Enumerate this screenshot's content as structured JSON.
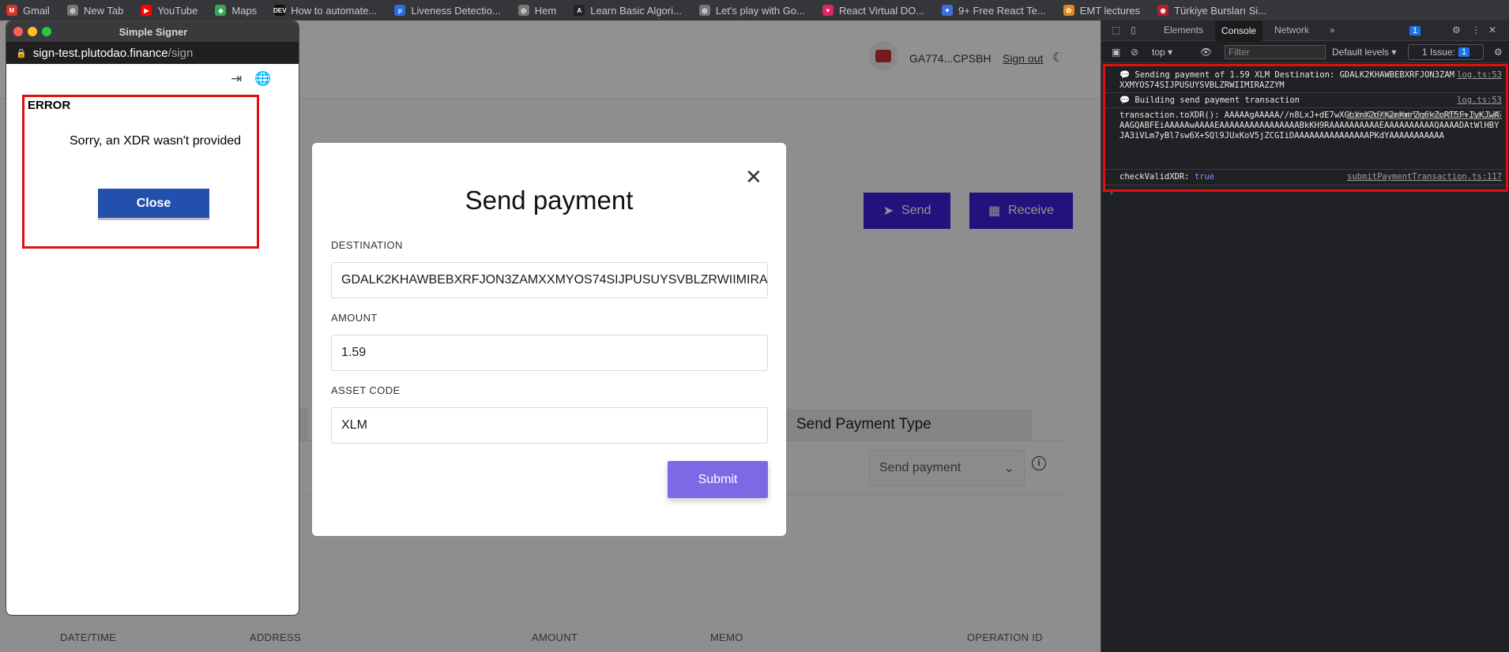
{
  "bookmarks": [
    {
      "label": "Gmail",
      "icon": "gmail-icon",
      "color": "#d93025",
      "glyph": "M"
    },
    {
      "label": "New Tab",
      "icon": "globe-icon",
      "color": "#777777",
      "glyph": "◎"
    },
    {
      "label": "YouTube",
      "icon": "youtube-icon",
      "color": "#ff0000",
      "glyph": "▶"
    },
    {
      "label": "Maps",
      "icon": "maps-icon",
      "color": "#34a853",
      "glyph": "◆"
    },
    {
      "label": "How to automate...",
      "icon": "dev-icon",
      "color": "#111111",
      "glyph": "DEV"
    },
    {
      "label": "Liveness Detectio...",
      "icon": "p-icon",
      "color": "#2b6de0",
      "glyph": "p"
    },
    {
      "label": "Hem",
      "icon": "globe-icon",
      "color": "#777777",
      "glyph": "◎"
    },
    {
      "label": "Learn Basic Algori...",
      "icon": "a-icon",
      "color": "#222222",
      "glyph": "A"
    },
    {
      "label": "Let's play with Go...",
      "icon": "globe-icon",
      "color": "#777777",
      "glyph": "◎"
    },
    {
      "label": "React Virtual DO...",
      "icon": "heart-icon",
      "color": "#e0245e",
      "glyph": "♥"
    },
    {
      "label": "9+ Free React Te...",
      "icon": "react-icon",
      "color": "#3d6ee0",
      "glyph": "✦"
    },
    {
      "label": "EMT lectures",
      "icon": "emt-icon",
      "color": "#e08a1e",
      "glyph": "✿"
    },
    {
      "label": "Türkiye Bursları Si...",
      "icon": "tb-icon",
      "color": "#b41e2e",
      "glyph": "◉"
    }
  ],
  "header": {
    "account": "GA774...CPSBH",
    "signout": "Sign out",
    "moon": "☾"
  },
  "actions": {
    "send": "Send",
    "receive": "Receive"
  },
  "payment_type": {
    "tab_label": "Send Payment Type",
    "select_value": "Send payment"
  },
  "table": {
    "headers": [
      "DATE/TIME",
      "ADDRESS",
      "AMOUNT",
      "MEMO",
      "OPERATION ID"
    ]
  },
  "modal": {
    "title": "Send payment",
    "destination_label": "DESTINATION",
    "destination_value": "GDALK2KHAWBEBXRFJON3ZAMXXMYOS74SIJPUSUYSVBLZRWIIMIRAZZ",
    "amount_label": "AMOUNT",
    "amount_value": "1.59",
    "asset_label": "ASSET CODE",
    "asset_value": "XLM",
    "submit": "Submit"
  },
  "popup": {
    "title": "Simple Signer",
    "url_host": "sign-test.plutodao.finance",
    "url_path": "/sign",
    "error_title": "ERROR",
    "error_message": "Sorry, an XDR wasn't provided",
    "close_label": "Close"
  },
  "devtools": {
    "tabs": [
      "Elements",
      "Console",
      "Network"
    ],
    "context": "top",
    "filter_placeholder": "Filter",
    "levels": "Default levels",
    "issues_label": "1 Issue:",
    "issues_count": "1",
    "header_badge": "1",
    "logs": [
      {
        "text": "💬 Sending payment of 1.59 XLM Destination: GDALK2KHAWBEBXRFJON3ZAMXXMYOS74SIJPUSUYSVBLZRWIIMIRAZZYM",
        "source": "log.ts:53"
      },
      {
        "text": "💬 Building send payment transaction",
        "source": "log.ts:53"
      },
      {
        "text": "transaction.toXDR(): AAAAAgAAAAA//n8LxJ+dE7wXGbYnX2d/X2nKmrZq6kZoRT5F+IyKJwAAAGQABFEiAAAAAwAAAAEAAAAAAAAAAAAAAAABkKH9RAAAAAAAAAAEAAAAAAAAAAQAAAADAtWlHBYJA3iVLm7yBl7sw6X+SQl9JUxKoV5jZCGIiDAAAAAAAAAAAAAAAPKdYAAAAAAAAAAA",
        "source": "submitPaymentTransaction.ts:115"
      },
      {
        "text": "checkValidXDR: ",
        "bool": "true",
        "source": "submitPaymentTransaction.ts:117"
      }
    ]
  }
}
